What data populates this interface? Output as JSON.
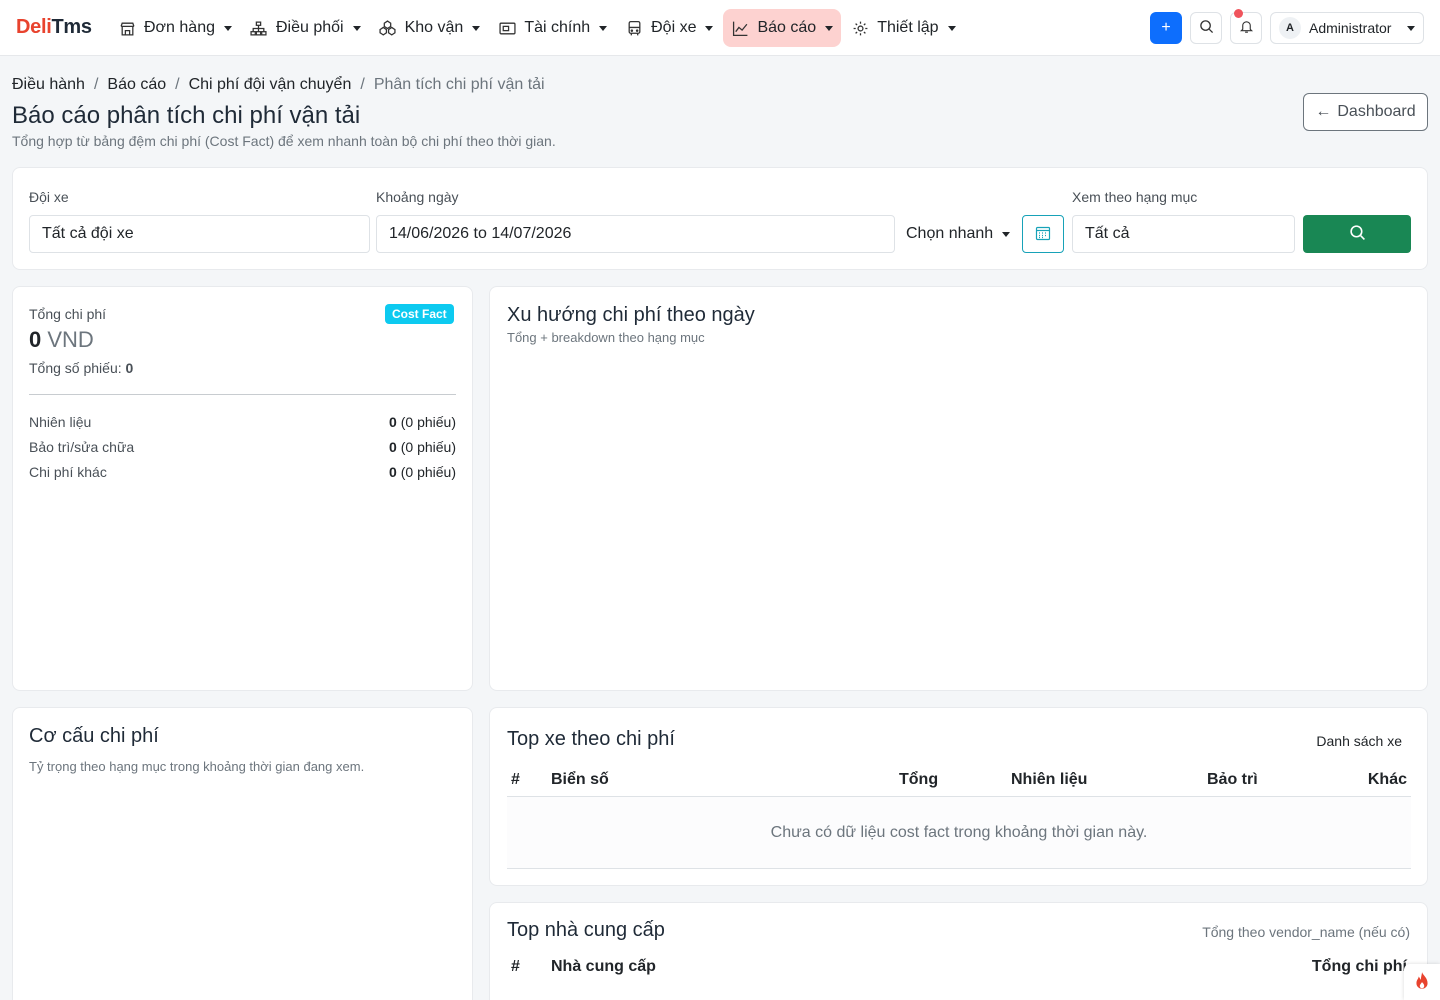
{
  "brand": {
    "part1": "Deli",
    "part2": "Tms"
  },
  "nav": {
    "items": [
      {
        "label": "Đơn hàng",
        "icon": "store-icon"
      },
      {
        "label": "Điều phối",
        "icon": "network-icon"
      },
      {
        "label": "Kho vận",
        "icon": "boxes-icon"
      },
      {
        "label": "Tài chính",
        "icon": "wallet-icon"
      },
      {
        "label": "Đội xe",
        "icon": "bus-icon"
      },
      {
        "label": "Báo cáo",
        "icon": "chart-line-icon"
      },
      {
        "label": "Thiết lập",
        "icon": "gear-icon"
      }
    ],
    "active": "Báo cáo"
  },
  "topright": {
    "plus": "+",
    "user_initial": "A",
    "user_name": "Administrator"
  },
  "breadcrumb": {
    "items": [
      "Điều hành",
      "Báo cáo",
      "Chi phí đội vận chuyển",
      "Phân tích chi phí vận tải"
    ]
  },
  "page": {
    "title": "Báo cáo phân tích chi phí vận tải",
    "subtitle": "Tổng hợp từ bảng đệm chi phí (Cost Fact) để xem nhanh toàn bộ chi phí theo thời gian.",
    "dashboard_btn": "Dashboard"
  },
  "filters": {
    "fleet_label": "Đội xe",
    "fleet_value": "Tất cả đội xe",
    "range_label": "Khoảng ngày",
    "range_value": "14/06/2026 to 14/07/2026",
    "quick_label": "Chọn nhanh",
    "category_label": "Xem theo hạng mục",
    "category_value": "Tất cả"
  },
  "summary": {
    "total_label": "Tổng chi phí",
    "badge": "Cost Fact",
    "total_value": "0",
    "currency": "VND",
    "count_label": "Tổng số phiếu:",
    "count_value": "0",
    "rows": [
      {
        "label": "Nhiên liệu",
        "value": "0",
        "count": "(0 phiếu)"
      },
      {
        "label": "Bảo trì/sửa chữa",
        "value": "0",
        "count": "(0 phiếu)"
      },
      {
        "label": "Chi phí khác",
        "value": "0",
        "count": "(0 phiếu)"
      }
    ]
  },
  "trend": {
    "title": "Xu hướng chi phí theo ngày",
    "subtitle": "Tổng + breakdown theo hạng mục"
  },
  "structure": {
    "title": "Cơ cấu chi phí",
    "subtitle": "Tỷ trọng theo hạng mục trong khoảng thời gian đang xem."
  },
  "top_vehicles": {
    "title": "Top xe theo chi phí",
    "link": "Danh sách xe",
    "columns": [
      "#",
      "Biển số",
      "Tổng",
      "Nhiên liệu",
      "Bảo trì",
      "Khác"
    ],
    "empty": "Chưa có dữ liệu cost fact trong khoảng thời gian này."
  },
  "top_vendors": {
    "title": "Top nhà cung cấp",
    "note": "Tổng theo vendor_name (nếu có)",
    "columns": [
      "#",
      "Nhà cung cấp",
      "Tổng chi phí"
    ]
  },
  "colors": {
    "accent": "#0d6efd",
    "success": "#198754",
    "info": "#0dcaf0",
    "brand_red": "#e8432e",
    "active_nav": "#fdd2d0"
  }
}
